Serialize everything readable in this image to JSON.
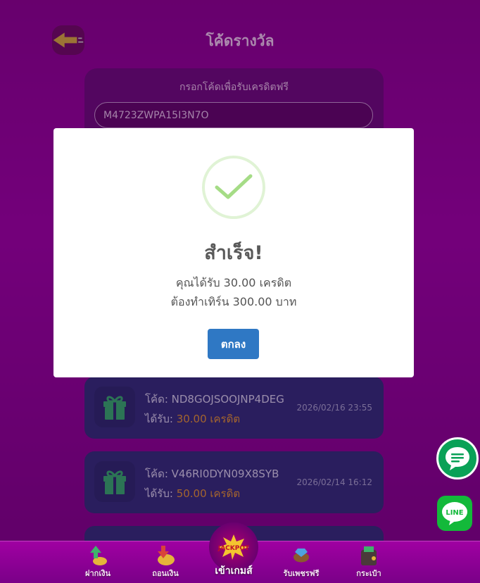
{
  "header": {
    "title": "โค้ดรางวัล"
  },
  "code_form": {
    "label": "กรอกโค้ดเพื่อรับเครดิตฟรี",
    "input_value": "M4723ZWPA15I3N7O"
  },
  "rewards": [
    {
      "code_label": "โค้ด: ND8GOJSOOJNP4DEG",
      "amount_prefix": "ได้รับ: ",
      "amount_value": "30.00 เครดิต",
      "time": "2026/02/16 23:55"
    },
    {
      "code_label": "โค้ด: V46RI0DYN09X8SYB",
      "amount_prefix": "ได้รับ: ",
      "amount_value": "50.00 เครดิต",
      "time": "2026/02/14 16:12"
    }
  ],
  "modal": {
    "title": "สำเร็จ!",
    "line1": "คุณได้รับ 30.00 เครดิต",
    "line2": "ต้องทำเทิร์น 300.00 บาท",
    "ok_label": "ตกลง"
  },
  "bottom_nav": {
    "deposit": "ฝากเงิน",
    "withdraw": "ถอนเงิน",
    "play": "เข้าเกมส์",
    "jackpot_badge": "JACKPOT",
    "free_gems": "รับเพชรฟรี",
    "wallet": "กระเป๋า"
  },
  "fab": {
    "line_label": "LINE"
  },
  "colors": {
    "background": "#9c00a4",
    "card": "#2b2f78",
    "accent_amount": "#e59a2e",
    "ok_button": "#2f78c4",
    "success_check": "#a5dc86"
  }
}
